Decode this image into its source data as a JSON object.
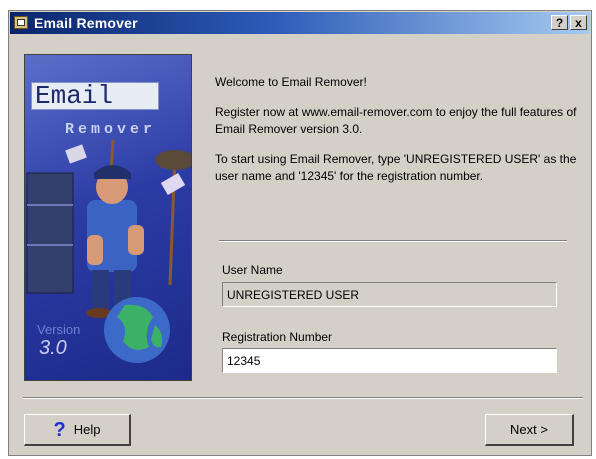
{
  "window": {
    "title": "Email Remover",
    "help_glyph": "?",
    "close_glyph": "x"
  },
  "side_panel": {
    "logo_title": "Email",
    "logo_subtitle": "Remover",
    "version_label": "Version",
    "version_number": "3.0"
  },
  "content": {
    "welcome": "Welcome to Email Remover!",
    "register_text": "Register now at www.email-remover.com to enjoy the full features of Email Remover version 3.0.",
    "instructions": "To start using Email Remover, type 'UNREGISTERED USER' as the user name and '12345' for the registration number."
  },
  "form": {
    "user_name_label": "User Name",
    "user_name_value": "UNREGISTERED USER",
    "registration_label": "Registration Number",
    "registration_value": "12345"
  },
  "buttons": {
    "help_icon": "?",
    "help_label": "Help",
    "next_label": "Next >"
  },
  "colors": {
    "titlebar_start": "#0a246a",
    "titlebar_end": "#a6caf0",
    "dialog_face": "#d4d0c8",
    "panel_blue": "#2c3ca6"
  }
}
